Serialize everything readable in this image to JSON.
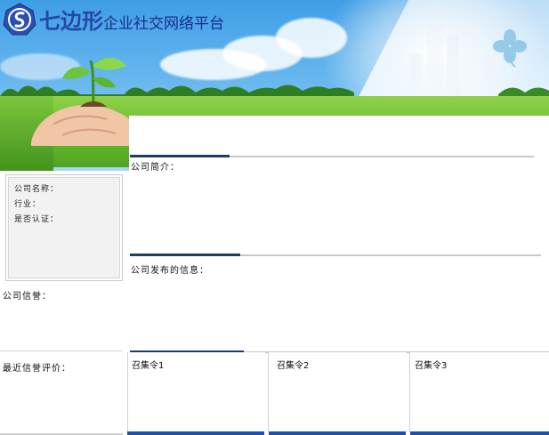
{
  "header": {
    "brand": "七边形",
    "subtitle": "企业社交网络平台"
  },
  "profile": {
    "company_name_label": "公司名称：",
    "industry_label": "行业：",
    "verified_label": "是否认证："
  },
  "sections": {
    "intro_label": "公司简介：",
    "posts_label": "公司发布的信息：",
    "credit_label": "公司信誉：",
    "recent_reviews_label": "最近信誉评价："
  },
  "cards": [
    {
      "label": "召集令1"
    },
    {
      "label": "召集令2"
    },
    {
      "label": "召集令3"
    }
  ],
  "colors": {
    "accent_dark": "#1f3b66",
    "brand_blue": "#2746a8",
    "card_bottom": "#1f4fa8"
  }
}
